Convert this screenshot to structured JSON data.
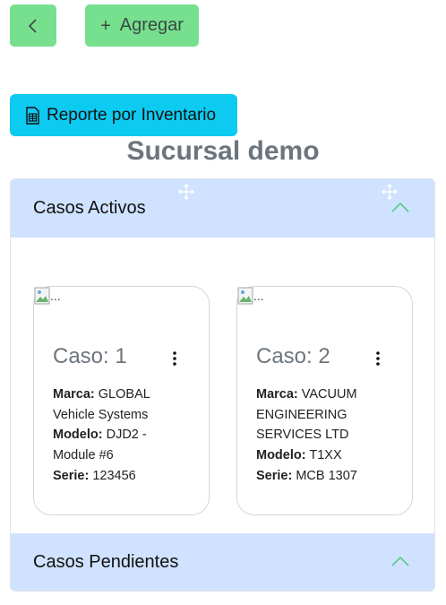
{
  "toolbar": {
    "back_icon": "chevron-left-icon",
    "add_icon": "plus-icon",
    "add_label": "Agregar",
    "report_icon": "file-spreadsheet-icon",
    "report_label": "Reporte por Inventario"
  },
  "page": {
    "title": "Sucursal demo"
  },
  "accordion": {
    "activos": {
      "label": "Casos Activos",
      "expanded": true
    },
    "pendientes": {
      "label": "Casos Pendientes",
      "expanded": true
    }
  },
  "cases": [
    {
      "img_alt": "...",
      "title": "Caso: 1",
      "marca_label": "Marca:",
      "marca": "GLOBAL Vehicle Systems",
      "modelo_label": "Modelo:",
      "modelo": "DJD2 - Module #6",
      "serie_label": "Serie:",
      "serie": "123456"
    },
    {
      "img_alt": "...",
      "title": "Caso: 2",
      "marca_label": "Marca:",
      "marca": "VACUUM ENGINEERING SERVICES LTD",
      "modelo_label": "Modelo:",
      "modelo": "T1XX",
      "serie_label": "Serie:",
      "serie": "MCB 1307"
    }
  ],
  "colors": {
    "button_green": "#77e08f",
    "button_info": "#0dcaf0",
    "accordion_header": "#cfe2ff",
    "title_gray": "#6c757d",
    "chevron_green": "#5cc98a"
  }
}
